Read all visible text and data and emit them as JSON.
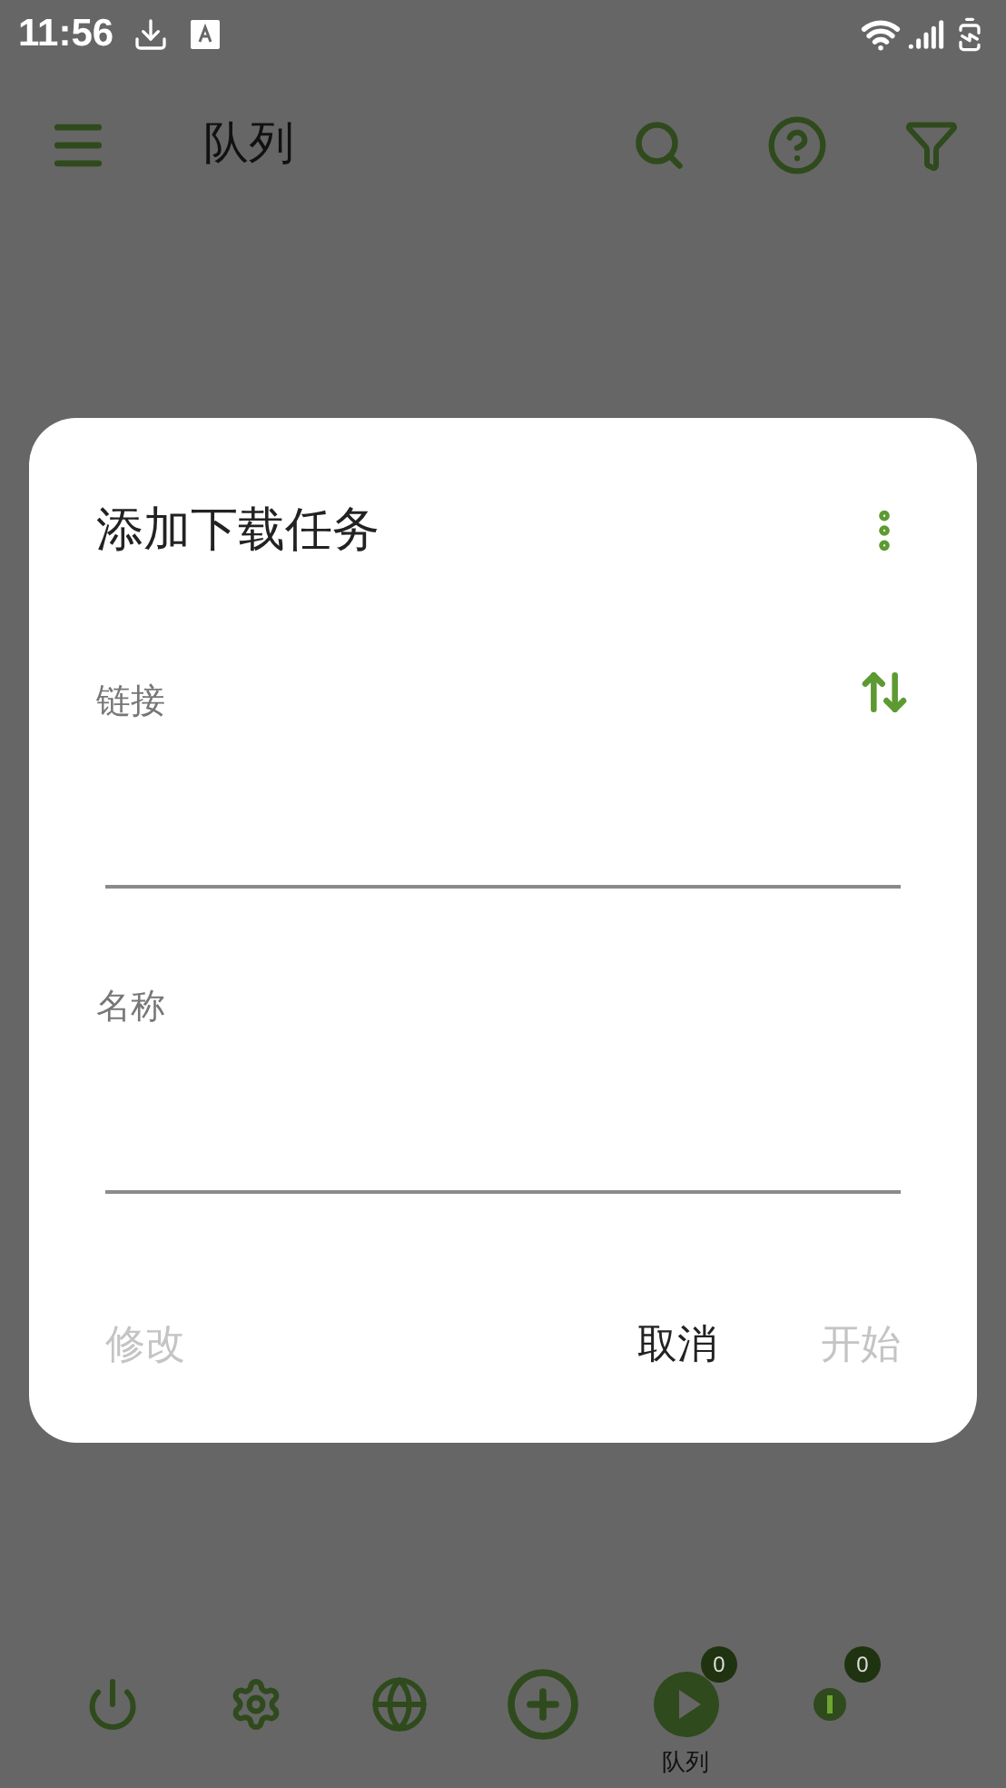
{
  "status_bar": {
    "time": "11:56"
  },
  "app_bar": {
    "title": "队列"
  },
  "dialog": {
    "title": "添加下载任务",
    "fields": [
      {
        "label": "链接",
        "swap_button": true
      },
      {
        "label": "名称",
        "swap_button": false
      }
    ],
    "buttons": [
      {
        "label": "修改",
        "disabled": true
      },
      {
        "label": "取消",
        "disabled": false
      },
      {
        "label": "开始",
        "disabled": true
      }
    ]
  },
  "bottom_nav": [
    {
      "kind": "power"
    },
    {
      "kind": "settings"
    },
    {
      "kind": "globe"
    },
    {
      "kind": "add"
    },
    {
      "kind": "play",
      "label": "队列",
      "badge": "0"
    },
    {
      "kind": "dots",
      "badge": "0"
    }
  ]
}
